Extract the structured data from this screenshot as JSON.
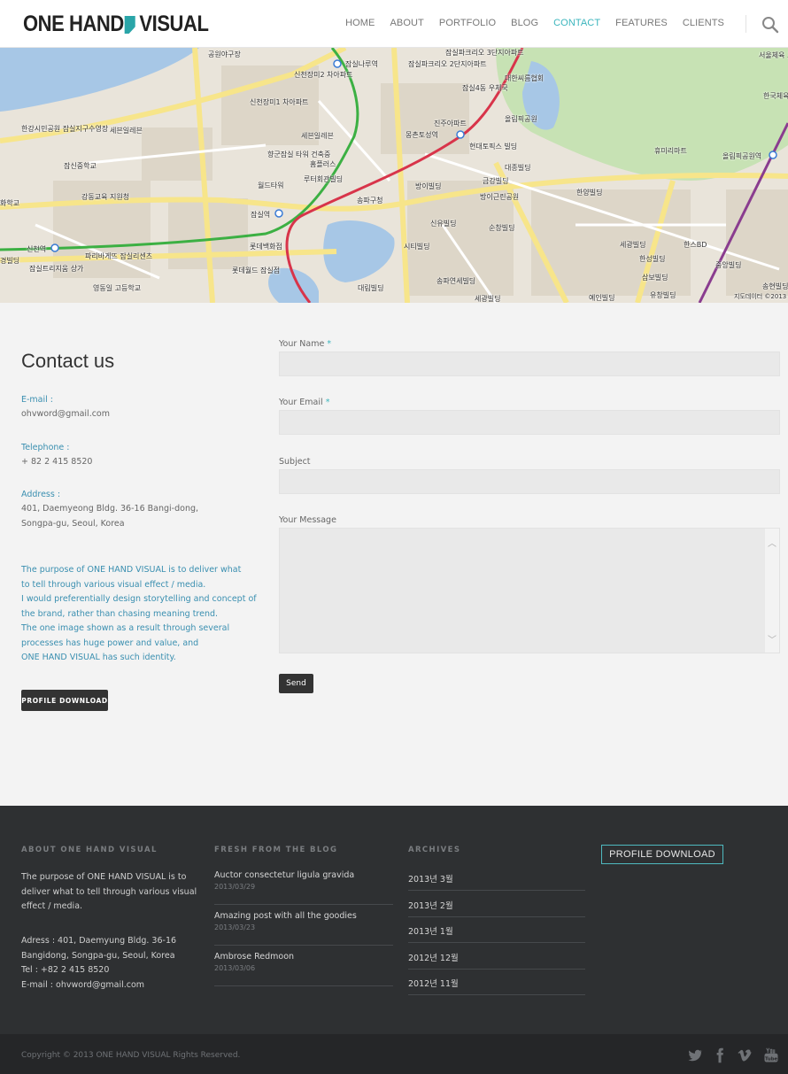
{
  "header": {
    "logo_left": "ONE HAND",
    "logo_right": "VISUAL",
    "nav": [
      "HOME",
      "ABOUT",
      "PORTFOLIO",
      "BLOG",
      "CONTACT",
      "FEATURES",
      "CLIENTS"
    ],
    "active_nav": "CONTACT"
  },
  "map": {
    "labels": [
      "잠실나루역",
      "신천장미2 차아파트",
      "잠실파크리오 3단지아파트",
      "잠실파크리오 2단지아파트",
      "대한씨름협회",
      "공원야구장",
      "한강시민공원 잠실지구수영장",
      "세븐일레븐",
      "신천장미1 차아파트",
      "잠실4동 우체국",
      "진주아파트",
      "올림픽공원",
      "서울체육 고등학교",
      "한국체육 대학교",
      "잠신중학교",
      "세븐일레븐",
      "몽촌토성역",
      "현대토픽스 빌딩",
      "홈플러스",
      "대종빌딩",
      "휴미리마트",
      "올림픽공원역",
      "향군잠실 타워 건축중",
      "루터회관빌딩",
      "월드타워",
      "금강빌딩",
      "방이빌딩",
      "송파구청",
      "방이근린공원",
      "한양빌딩",
      "강동교육 지원청",
      "잠실역",
      "신유빌딩",
      "순창빌딩",
      "신천역",
      "파리바게뜨 잠실리센츠",
      "롯데백화점",
      "시티빌딩",
      "세광빌딩",
      "한스BD",
      "잠실트리지움 상가",
      "롯데월드 잠실점",
      "한성빌딩",
      "송파연세빌딩",
      "삼보빌딩",
      "영동일 고등학교",
      "대림빌딩",
      "세광빌딩",
      "예인빌딩",
      "유창빌딩",
      "송현빌딩",
      "중앙빌딩",
      "경빌딩",
      "화학교",
      "지도데이터 ©2013"
    ]
  },
  "contact": {
    "title": "Contact us",
    "email_label": "E-mail :",
    "email": "ohvword@gmail.com",
    "telephone_label": "Telephone :",
    "telephone": "+ 82 2 415 8520",
    "address_label": "Address :",
    "address_line1": "401, Daemyeong Bldg. 36-16 Bangi-dong,",
    "address_line2": "Songpa-gu, Seoul, Korea",
    "purpose_lines": [
      "The purpose of ONE HAND VISUAL is to deliver what",
      "to tell through various visual effect / media.",
      "I would preferentially design storytelling and concept of",
      "the brand, rather than chasing meaning trend.",
      "The one image shown as a result through several",
      "processes has huge power and value, and",
      "ONE HAND VISUAL has such identity."
    ],
    "profile_button": "PROFILE DOWNLOAD"
  },
  "form": {
    "name_label": "Your Name",
    "email_label": "Your Email",
    "subject_label": "Subject",
    "message_label": "Your Message",
    "required_mark": "*",
    "name_value": "",
    "email_value": "",
    "subject_value": "",
    "message_value": "",
    "send": "Send"
  },
  "footer": {
    "about_heading": "ABOUT ONE HAND VISUAL",
    "about_lines": [
      "The purpose of ONE HAND VISUAL is to",
      "deliver what to tell through various visual",
      "effect / media."
    ],
    "contact_lines": [
      "Adress : 401, Daemyung Bldg. 36-16",
      "Bangidong, Songpa-gu, Seoul, Korea",
      "Tel : +82 2 415 8520",
      "E-mail : ohvword@gmail.com"
    ],
    "blog_heading": "FRESH FROM THE BLOG",
    "blog": [
      {
        "title": "Auctor consectetur ligula gravida",
        "date": "2013/03/29"
      },
      {
        "title": "Amazing post with all the goodies",
        "date": "2013/03/23"
      },
      {
        "title": "Ambrose Redmoon",
        "date": "2013/03/06"
      }
    ],
    "archives_heading": "ARCHIVES",
    "archives": [
      "2013년 3월",
      "2013년 2월",
      "2013년 1월",
      "2012년 12월",
      "2012년 11월"
    ],
    "profile_button": "PROFILE DOWNLOAD",
    "copyright": "Copyright © 2013 ONE HAND VISUAL Rights Reserved.",
    "social_icons": [
      "twitter-icon",
      "facebook-icon",
      "vimeo-icon",
      "youtube-icon"
    ]
  },
  "colors": {
    "accent": "#3bb5bd",
    "link_blue": "#3a8fb0",
    "footer_bg": "#2e3032",
    "bottom_bg": "#252628",
    "button_dark": "#333333"
  }
}
